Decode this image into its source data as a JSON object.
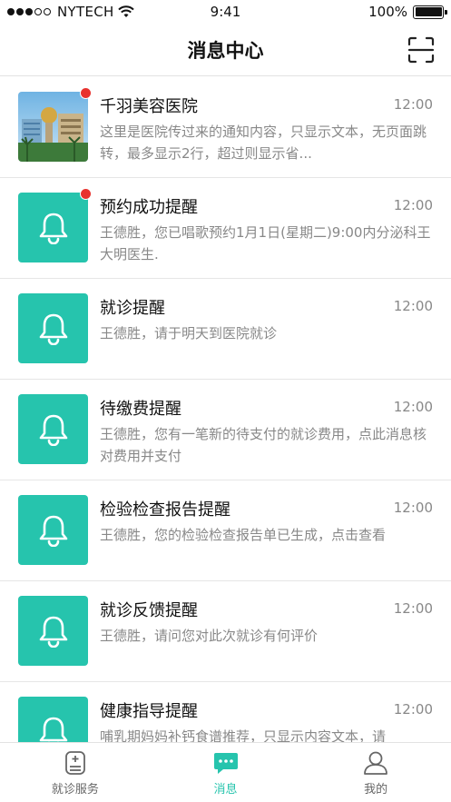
{
  "status_bar": {
    "carrier": "NYTECH",
    "time": "9:41",
    "battery": "100%"
  },
  "nav": {
    "title": "消息中心"
  },
  "messages": [
    {
      "title": "千羽美容医院",
      "time": "12:00",
      "content": "这里是医院传过来的通知内容，只显示文本，无页面跳转，最多显示2行，超过则显示省...",
      "unread": true,
      "icon": "hospital-photo"
    },
    {
      "title": "预约成功提醒",
      "time": "12:00",
      "content": "王德胜，您已唱歌预约1月1日(星期二)9:00内分泌科王大明医生.",
      "unread": true,
      "icon": "bell-icon"
    },
    {
      "title": "就诊提醒",
      "time": "12:00",
      "content": "王德胜，请于明天到医院就诊",
      "unread": false,
      "icon": "bell-icon"
    },
    {
      "title": "待缴费提醒",
      "time": "12:00",
      "content": "王德胜，您有一笔新的待支付的就诊费用，点此消息核对费用并支付",
      "unread": false,
      "icon": "bell-icon"
    },
    {
      "title": "检验检查报告提醒",
      "time": "12:00",
      "content": "王德胜，您的检验检查报告单已生成，点击查看",
      "unread": false,
      "icon": "bell-icon"
    },
    {
      "title": "就诊反馈提醒",
      "time": "12:00",
      "content": "王德胜，请问您对此次就诊有何评价",
      "unread": false,
      "icon": "bell-icon"
    },
    {
      "title": "健康指导提醒",
      "time": "12:00",
      "content": "哺乳期妈妈补钙食谱推荐，只显示内容文本，请",
      "unread": false,
      "icon": "bell-icon"
    }
  ],
  "tabs": [
    {
      "label": "就诊服务",
      "icon": "medical-service-icon",
      "active": false
    },
    {
      "label": "消息",
      "icon": "chat-bubble-icon",
      "active": true
    },
    {
      "label": "我的",
      "icon": "user-icon",
      "active": false
    }
  ],
  "colors": {
    "accent": "#26c4ad",
    "unread": "#e8322e",
    "muted_text": "#888888"
  }
}
